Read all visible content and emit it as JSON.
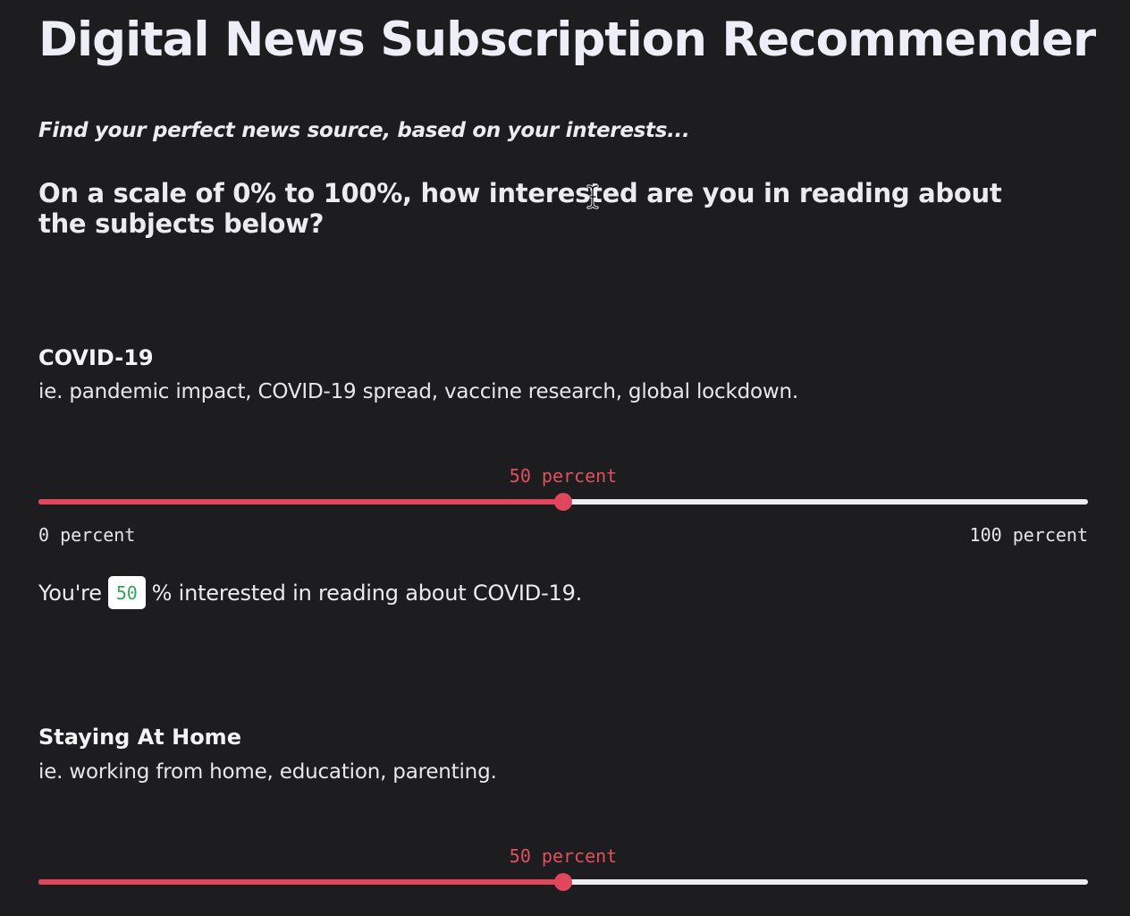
{
  "header": {
    "title": "Digital News Subscription Recommender",
    "subtitle": "Find your perfect news source, based on your interests...",
    "question": "On a scale of 0% to 100%, how interested are you in reading about the subjects below?"
  },
  "topics": [
    {
      "title": "COVID-19",
      "description": "ie. pandemic impact, COVID-19 spread, vaccine research, global lockdown.",
      "slider": {
        "value": 50,
        "value_label": "50 percent",
        "min_label": "0 percent",
        "max_label": "100 percent"
      },
      "result": {
        "prefix": "You're",
        "value": "50",
        "suffix": "% interested in reading about COVID-19."
      }
    },
    {
      "title": "Staying At Home",
      "description": "ie. working from home, education, parenting.",
      "slider": {
        "value": 50,
        "value_label": "50 percent"
      }
    }
  ],
  "colors": {
    "background": "#1d1d1f",
    "accent": "#e0475c",
    "track": "#eeeef2",
    "badge_text": "#2ea55a"
  },
  "icons": {
    "cursor": "text-cursor-icon"
  }
}
